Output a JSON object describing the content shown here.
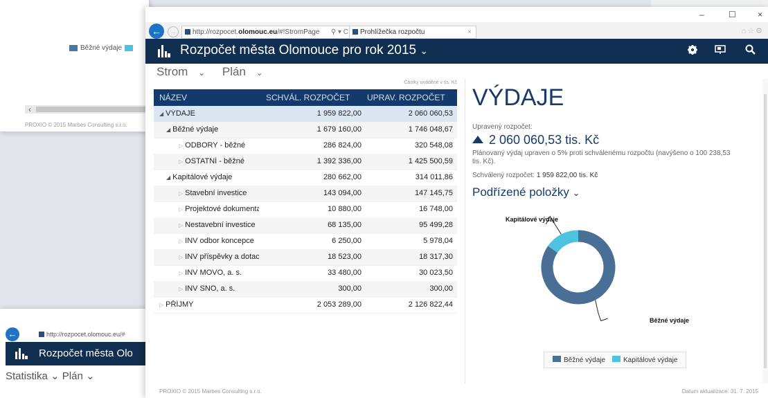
{
  "bg_window_1": {
    "legend_items": [
      {
        "label": "Běžné výdaje",
        "color": "#4a78a4"
      },
      {
        "label": "",
        "color": "#4ec3e0"
      }
    ],
    "footer": "PROXIO © 2015 Marbes Consulting s.r.o."
  },
  "bg_window_2": {
    "address": "http://rozpocet.olomouc.eu/#",
    "title": "Rozpočet města Olo",
    "nav_stats": "Statistika",
    "nav_plan": "Plán"
  },
  "browser": {
    "address_prefix": "http://rozpocet.",
    "address_domain": "olomouc.eu",
    "address_rest": "/#!StromPage",
    "address_icons": "⚲ ▾ C",
    "tab_title": "Prohlížečka rozpočtu",
    "tab_close": "×",
    "window_controls": [
      "–",
      "☐",
      "×"
    ]
  },
  "app": {
    "title": "Rozpočet města Olomouce pro rok 2015",
    "settings_icon": "gear-icon",
    "present_icon": "screen-icon",
    "search_icon": "search-icon"
  },
  "subnav": {
    "view": "Strom",
    "mode": "Plán"
  },
  "table": {
    "unit_note": "Částky uváděné v tis. Kč",
    "headers": [
      "NÁZEV",
      "SCHVÁL. ROZPOČET",
      "UPRAV. ROZPOČET"
    ],
    "rows": [
      {
        "name": "VÝDAJE",
        "approved": "1 959 822,00",
        "adjusted": "2 060 060,53",
        "level": 0,
        "expanded": true,
        "selected": true
      },
      {
        "name": "Běžné výdaje",
        "approved": "1 679 160,00",
        "adjusted": "1 746 048,67",
        "level": 1,
        "expanded": true
      },
      {
        "name": "ODBORY - běžné",
        "approved": "286 824,00",
        "adjusted": "320 548,08",
        "level": 2
      },
      {
        "name": "OSTATNÍ - běžné",
        "approved": "1 392 336,00",
        "adjusted": "1 425 500,59",
        "level": 2
      },
      {
        "name": "Kapitálové výdaje",
        "approved": "280 662,00",
        "adjusted": "314 011,86",
        "level": 1,
        "expanded": true
      },
      {
        "name": "Stavební investice",
        "approved": "143 094,00",
        "adjusted": "147 145,75",
        "level": 2
      },
      {
        "name": "Projektové dokumentace",
        "approved": "10 880,00",
        "adjusted": "16 748,00",
        "level": 2
      },
      {
        "name": "Nestavební investice",
        "approved": "68 135,00",
        "adjusted": "95 499,28",
        "level": 2
      },
      {
        "name": "INV odbor koncepce",
        "approved": "6 250,00",
        "adjusted": "5 978,04",
        "level": 2
      },
      {
        "name": "INV příspěvky a dotace",
        "approved": "18 523,00",
        "adjusted": "18 317,30",
        "level": 2
      },
      {
        "name": "INV MOVO, a. s.",
        "approved": "33 480,00",
        "adjusted": "30 023,50",
        "level": 2
      },
      {
        "name": "INV SNO, a. s.",
        "approved": "300,00",
        "adjusted": "300,00",
        "level": 2
      },
      {
        "name": "PŘÍJMY",
        "approved": "2 053 289,00",
        "adjusted": "2 126 822,44",
        "level": 0
      }
    ]
  },
  "detail": {
    "title": "VÝDAJE",
    "adjusted_label": "Upravený rozpočet:",
    "adjusted_value": "2 060 060,53 tis. Kč",
    "note": "Plánovaný výdaj upraven o 5% proti schválenému rozpočtu (navýšeno o 100 238,53 tis. Kč).",
    "approved_label": "Schválený rozpočet:",
    "approved_value": "1 959 822,00 tis. Kč",
    "sub_items_label": "Podřízené položky",
    "chart_label_capital": "Kapitálové výdaje",
    "chart_label_current": "Běžné výdaje",
    "legend": [
      {
        "label": "Běžné výdaje",
        "color": "#4a6f96"
      },
      {
        "label": "Kapitálové výdaje",
        "color": "#4ec3e0"
      }
    ]
  },
  "chart_data": {
    "type": "pie",
    "categories": [
      "Běžné výdaje",
      "Kapitálové výdaje"
    ],
    "values": [
      1746048.67,
      314011.86
    ],
    "colors": [
      "#4a6f96",
      "#4ec3e0"
    ],
    "legend_position": "bottom"
  },
  "footer": {
    "left": "PROXIO © 2015 Marbes Consulting s.r.o.",
    "right": "Datum aktualizace: 31. 7. 2015"
  },
  "colors": {
    "header": "#102e4f",
    "table_header": "#143a6b",
    "selected_row": "#dbe6f3",
    "accent": "#1a3a66"
  }
}
